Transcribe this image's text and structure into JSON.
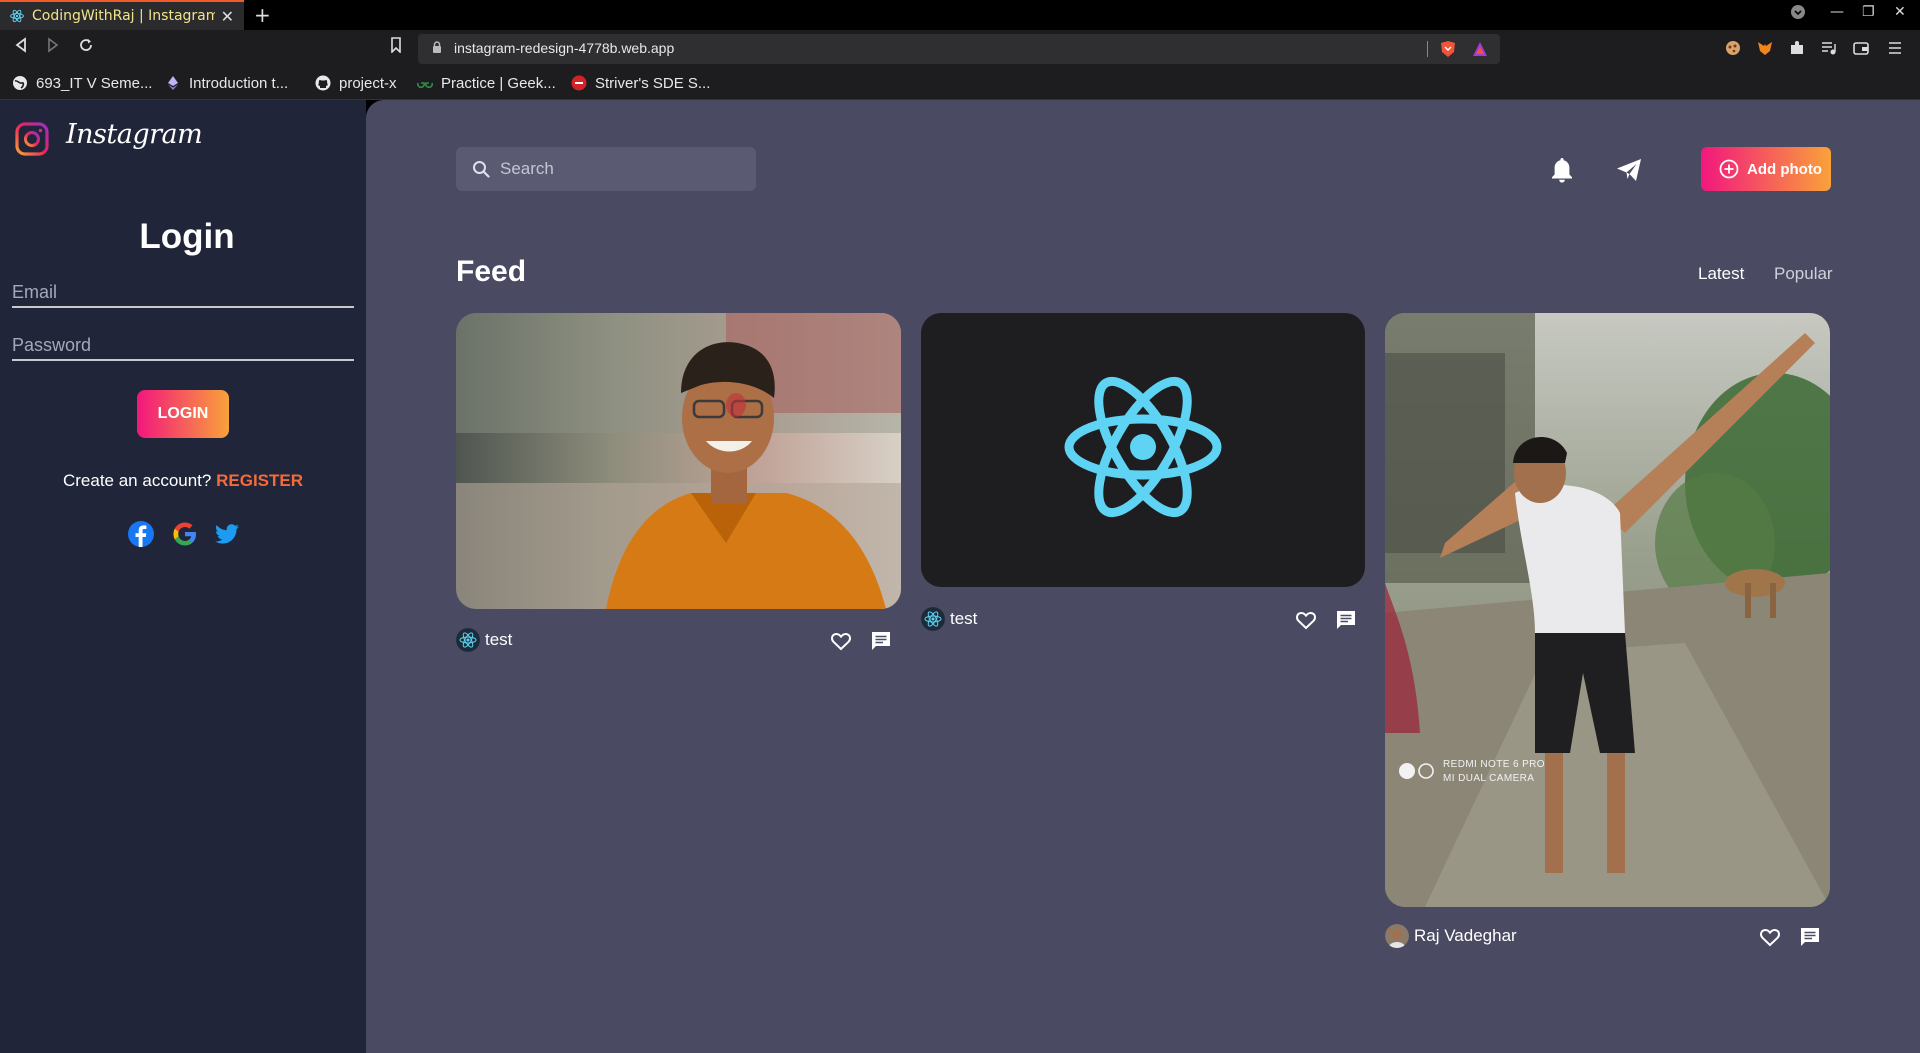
{
  "browser": {
    "tab_title": "CodingWithRaj | Instagram",
    "url": "instagram-redesign-4778b.web.app",
    "bookmarks": [
      {
        "label": "693_IT V Seme...",
        "icon": "globe-icon"
      },
      {
        "label": "Introduction t...",
        "icon": "ethereum-icon"
      },
      {
        "label": "project-x",
        "icon": "github-icon"
      },
      {
        "label": "Practice | Geek...",
        "icon": "geeksforgeeks-icon"
      },
      {
        "label": "Striver's SDE S...",
        "icon": "takeuforward-icon"
      }
    ]
  },
  "sidebar": {
    "logo_text": "Instagram",
    "login_title": "Login",
    "email_placeholder": "Email",
    "password_placeholder": "Password",
    "login_button": "LOGIN",
    "register_prompt": "Create an account?",
    "register_link": "REGISTER",
    "social": [
      "facebook-icon",
      "google-icon",
      "twitter-icon"
    ]
  },
  "header": {
    "search_placeholder": "Search",
    "add_photo": "Add photo"
  },
  "feed": {
    "title": "Feed",
    "sort_options": [
      "Latest",
      "Popular"
    ],
    "active_sort": "Latest",
    "posts": [
      {
        "author": "test",
        "image": "portrait photo of smiling young man in orange shirt"
      },
      {
        "author": "test",
        "image": "React logo on dark background"
      },
      {
        "author": "Raj Vadeghar",
        "image": "young man doing a dab pose on a street",
        "camera_line1": "REDMI NOTE 6 PRO",
        "camera_line2": "MI DUAL CAMERA"
      }
    ]
  },
  "colors": {
    "sidebar_bg": "#212539",
    "main_bg": "#4a4a62",
    "accent_gradient_start": "#f2177d",
    "accent_gradient_end": "#f9a23a",
    "register_link": "#f26b3a",
    "react_blue": "#5ed3f3"
  }
}
